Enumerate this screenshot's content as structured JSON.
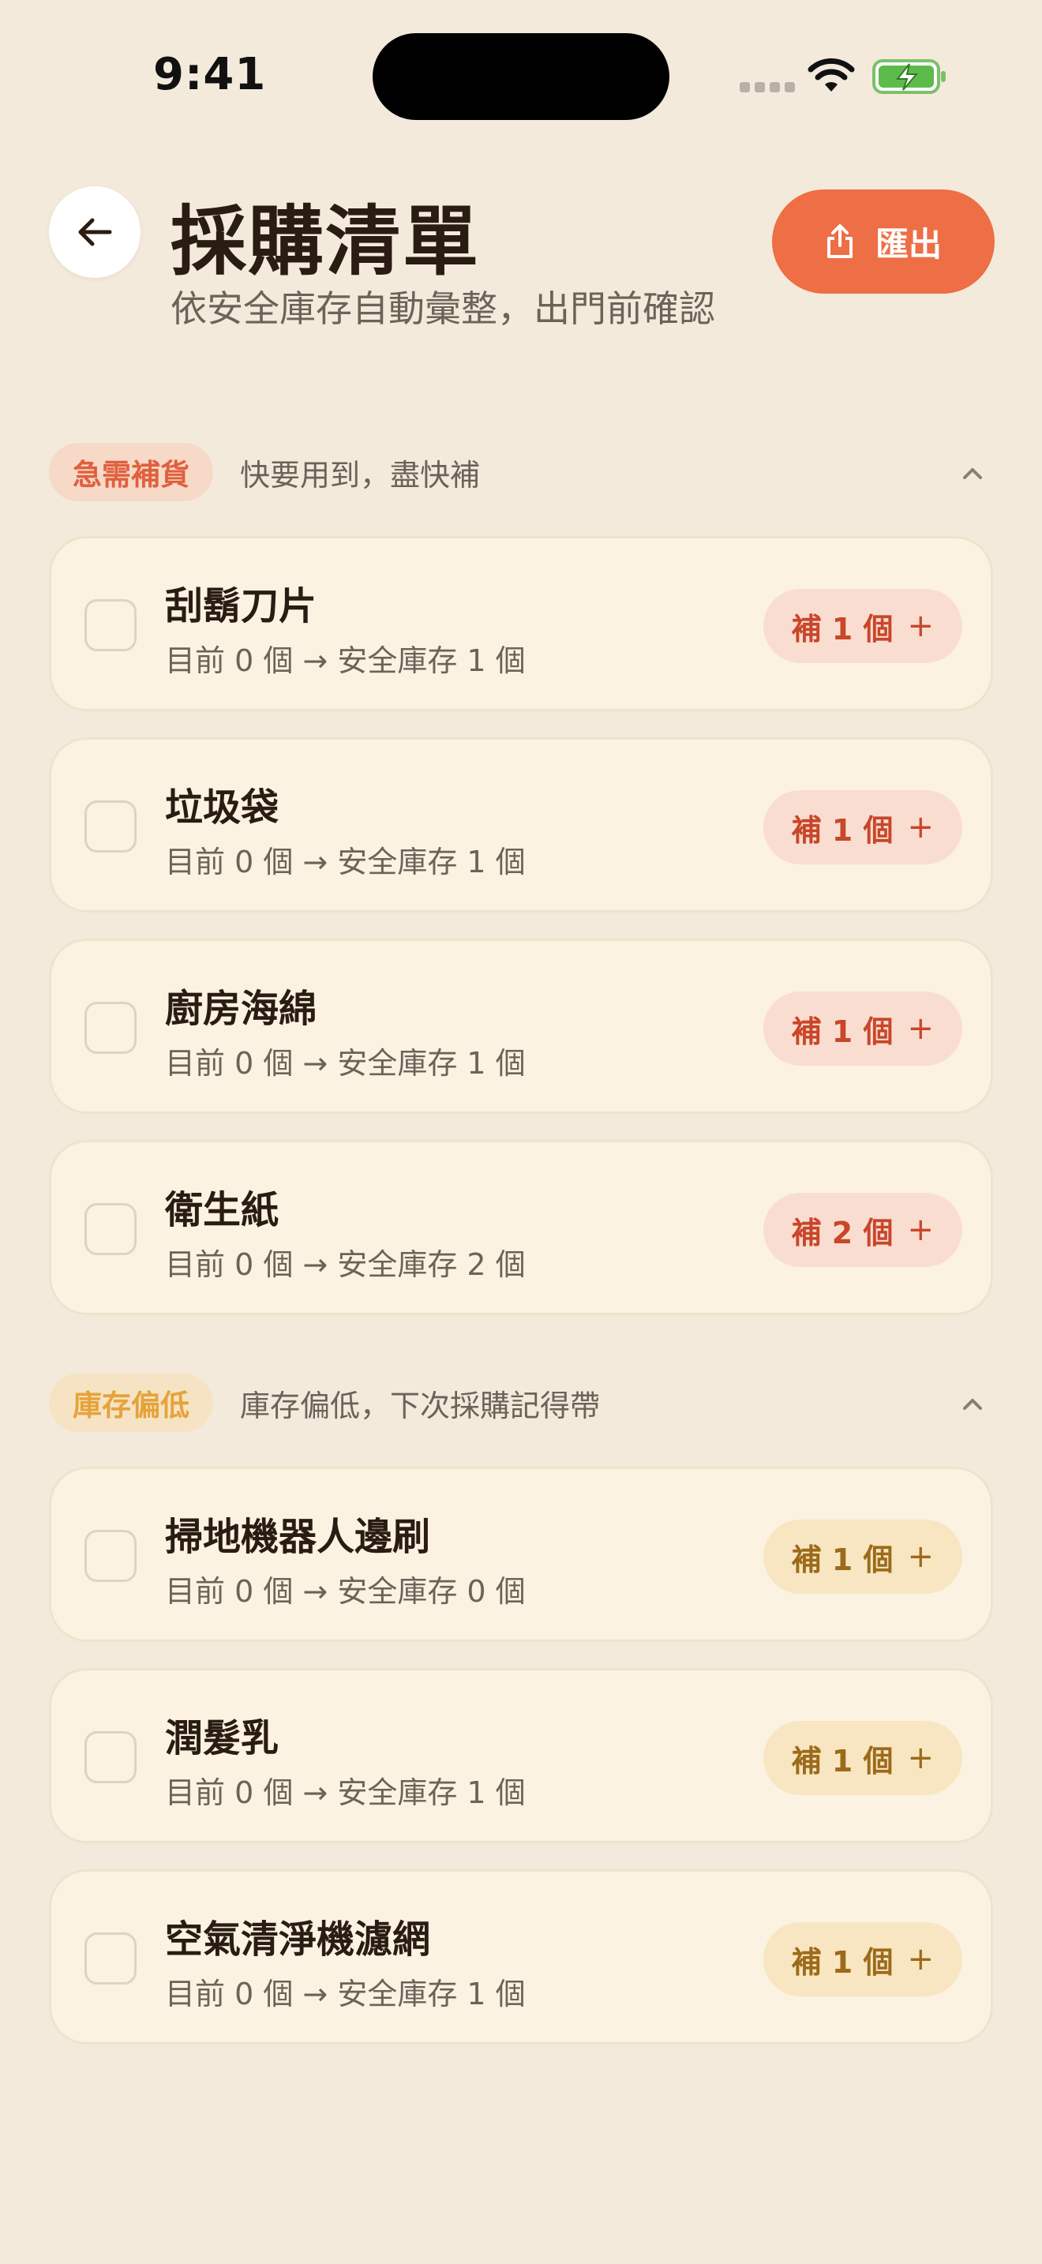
{
  "status_bar": {
    "time": "9:41"
  },
  "header": {
    "title": "採購清單",
    "subtitle": "依安全庫存自動彙整，出門前確認",
    "export_label": "匯出"
  },
  "sections": [
    {
      "badge": "急需補貨",
      "description": "快要用到，盡快補",
      "accent": "#E0603E",
      "items": [
        {
          "name": "刮鬍刀片",
          "detail": "目前 0 個 → 安全庫存 1 個",
          "restock": "補 1 個",
          "plus": "+"
        },
        {
          "name": "垃圾袋",
          "detail": "目前 0 個 → 安全庫存 1 個",
          "restock": "補 1 個",
          "plus": "+"
        },
        {
          "name": "廚房海綿",
          "detail": "目前 0 個 → 安全庫存 1 個",
          "restock": "補 1 個",
          "plus": "+"
        },
        {
          "name": "衛生紙",
          "detail": "目前 0 個 → 安全庫存 2 個",
          "restock": "補 2 個",
          "plus": "+"
        }
      ]
    },
    {
      "badge": "庫存偏低",
      "description": "庫存偏低，下次採購記得帶",
      "accent": "#E6A33A",
      "items": [
        {
          "name": "掃地機器人邊刷",
          "detail": "目前 0 個 → 安全庫存 0 個",
          "restock": "補 1 個",
          "plus": "+"
        },
        {
          "name": "潤髮乳",
          "detail": "目前 0 個 → 安全庫存 1 個",
          "restock": "補 1 個",
          "plus": "+"
        },
        {
          "name": "空氣清淨機濾網",
          "detail": "目前 0 個 → 安全庫存 1 個",
          "restock": "補 1 個",
          "plus": "+"
        }
      ]
    }
  ],
  "icons": {
    "back": "arrow-left-icon",
    "export": "share-icon",
    "collapse": "chevron-up-icon",
    "wifi": "wifi-icon",
    "battery": "battery-charging-icon"
  },
  "colors": {
    "background": "#F3EADC",
    "accent_button": "#EE6E45",
    "card": "#FBF2E2"
  }
}
